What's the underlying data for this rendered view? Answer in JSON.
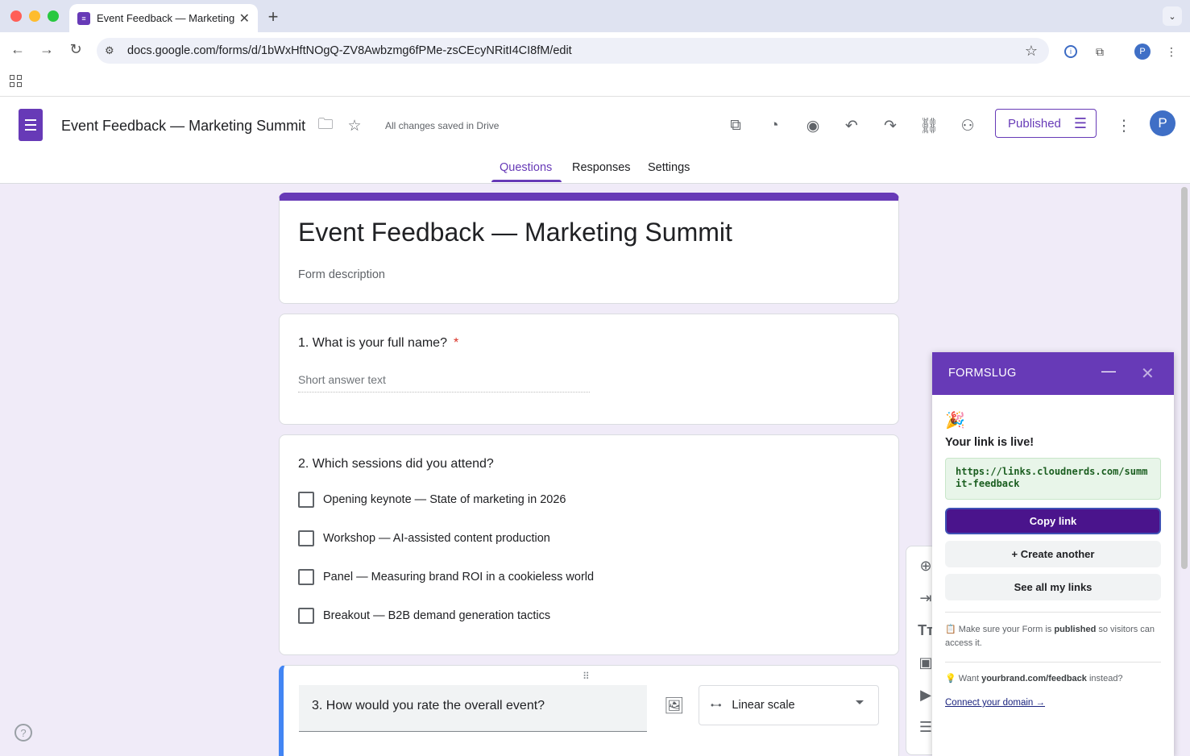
{
  "browser": {
    "tab_title": "Event Feedback — Marketing",
    "new_tab": "+",
    "url": "docs.google.com/forms/d/1bWxHftNOgQ-ZV8Awbzmg6fPMe-zsCEcyNRitI4CI8fM/edit",
    "profile_initial": "P"
  },
  "form_header": {
    "doc_title": "Event Feedback — Marketing Summit",
    "save_status": "All changes saved in Drive",
    "published_label": "Published",
    "avatar_initial": "P",
    "tabs": [
      "Questions",
      "Responses",
      "Settings"
    ],
    "active_tab": "Questions"
  },
  "form": {
    "title": "Event Feedback — Marketing Summit",
    "description_placeholder": "Form description",
    "q1": {
      "text": "1. What is your full name?",
      "required_mark": "*",
      "placeholder": "Short answer text"
    },
    "q2": {
      "text": "2. Which sessions did you attend?",
      "options": [
        "Opening keynote — State of marketing in 2026",
        "Workshop — AI-assisted content production",
        "Panel — Measuring brand ROI in a cookieless world",
        "Breakout — B2B demand generation tactics"
      ]
    },
    "q3": {
      "text": "3. How would you rate the overall event?",
      "type": "Linear scale"
    }
  },
  "panel": {
    "brand": "FORMSLUG",
    "emoji": "🎉",
    "heading": "Your link is live!",
    "link": "https://links.cloudnerds.com/summit-feedback",
    "copy_label": "Copy link",
    "create_label": "+ Create another",
    "see_all_label": "See all my links",
    "note1_prefix": "📋 Make sure your Form is ",
    "note1_bold": "published",
    "note1_suffix": " so visitors can access it.",
    "note2_prefix": "💡 Want ",
    "note2_bold": "yourbrand.com/feedback",
    "note2_suffix": " instead?",
    "connect_label": "Connect your domain →"
  },
  "colors": {
    "accent": "#673ab7",
    "canvas": "#f0ebf8",
    "link_bg": "#e8f5e9"
  }
}
